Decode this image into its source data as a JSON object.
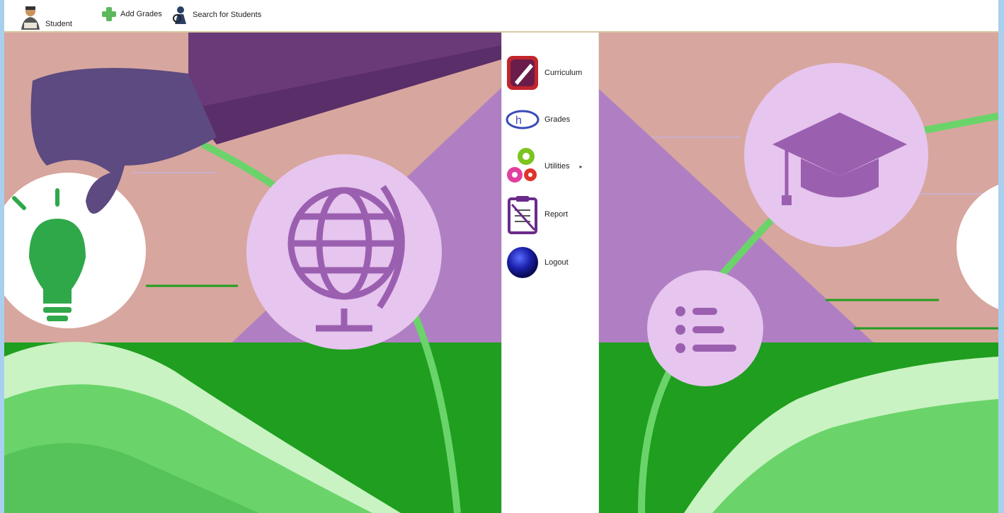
{
  "toolbar": {
    "student_label": "Student",
    "add_grades_label": "Add Grades",
    "search_students_label": "Search for Students"
  },
  "menu": {
    "items": [
      {
        "label": "Curriculum",
        "icon": "curriculum-icon"
      },
      {
        "label": "Grades",
        "icon": "grades-icon"
      },
      {
        "label": "Utilities",
        "icon": "gears-icon",
        "has_submenu": true
      },
      {
        "label": "Report",
        "icon": "clipboard-icon"
      },
      {
        "label": "Logout",
        "icon": "logout-orb-icon"
      }
    ]
  },
  "background": {
    "illustration": "education-themed background",
    "colors": {
      "sky": "#d7a69e",
      "triangle": "#b07fc3",
      "circle": "#e6c5ee",
      "icon_purple": "#9b5fb0",
      "grass": "#1f9e1f",
      "book_light": "#c9f3c2",
      "book_mid": "#6ad46a",
      "bulb": "#2fa84a",
      "sleeve": "#6a3a78",
      "hand": "#5c4a80"
    }
  }
}
